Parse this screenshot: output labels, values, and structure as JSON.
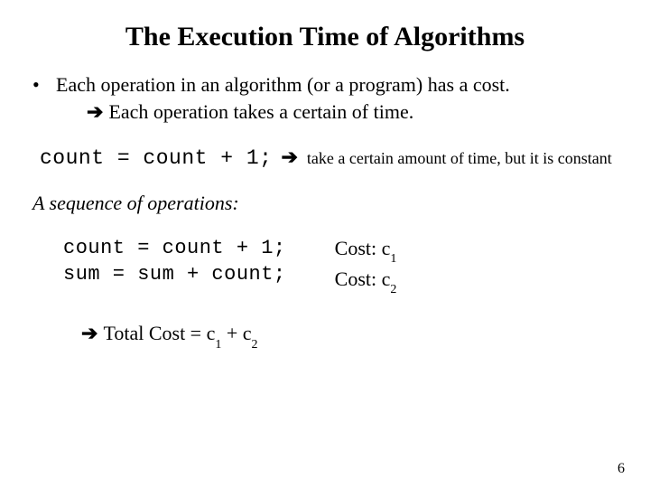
{
  "title": "The Execution Time of Algorithms",
  "bullet": {
    "mark": "•",
    "text": "Each operation in an algorithm (or a program) has a cost."
  },
  "subline": {
    "arrow": "➔",
    "text": "Each operation takes a certain of time."
  },
  "code_inline": {
    "code": "count = count + 1;",
    "arrow": "➔",
    "note": "take a certain amount of time, but it is constant"
  },
  "seq_heading": "A sequence of  operations:",
  "ops": [
    "count = count + 1;",
    "sum = sum + count;"
  ],
  "costs": {
    "label": "Cost: c",
    "subs": [
      "1",
      "2"
    ]
  },
  "total": {
    "arrow": "➔",
    "prefix": "Total Cost = c",
    "s1": "1",
    "mid": " + c",
    "s2": "2"
  },
  "pagenum": "6"
}
